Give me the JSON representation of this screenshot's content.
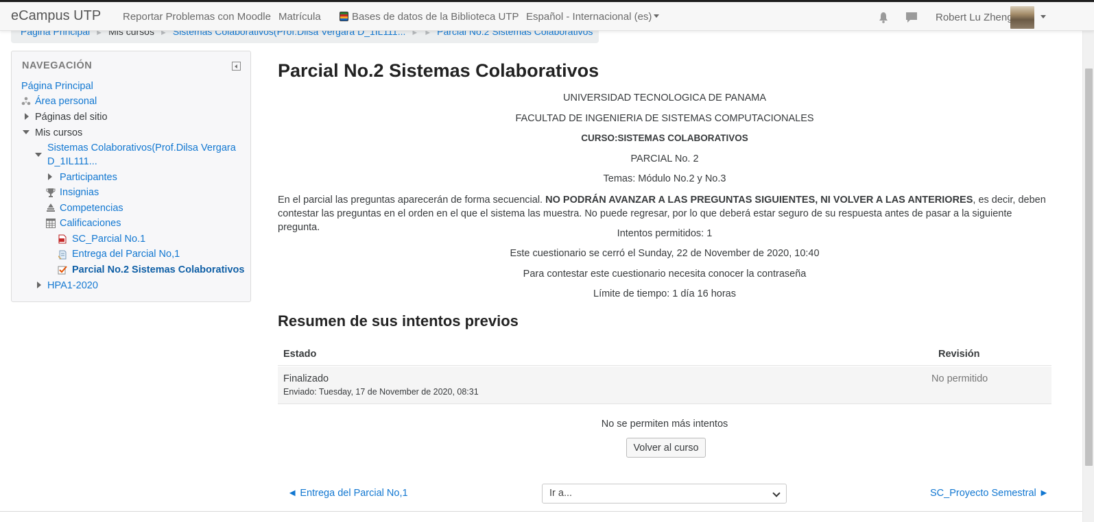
{
  "navbar": {
    "brand": "eCampus UTP",
    "links": [
      "Reportar Problemas con Moodle",
      "Matrícula",
      "Bases de datos de la Biblioteca UTP",
      "Español - Internacional (es)"
    ],
    "user_name": "Robert Lu Zheng"
  },
  "breadcrumb": {
    "items": [
      "Página Principal",
      "Mis cursos",
      "Sistemas Colaborativos(Prof.Dilsa Vergara D_1IL111...",
      "Parcial No.2 Sistemas Colaborativos"
    ]
  },
  "navigation": {
    "title": "NAVEGACIÓN",
    "home": "Página Principal",
    "personal_area": "Área personal",
    "site_pages": "Páginas del sitio",
    "my_courses": "Mis cursos",
    "course_line1": "Sistemas Colaborativos(Prof.Dilsa Vergara",
    "course_line2": "D_1IL111...",
    "participants": "Participantes",
    "badges": "Insignias",
    "competencies": "Competencias",
    "grades": "Calificaciones",
    "activity_1": "SC_Parcial No.1",
    "activity_2": "Entrega del Parcial No,1",
    "activity_3": "Parcial No.2 Sistemas Colaborativos",
    "other_course": "HPA1-2020"
  },
  "main": {
    "title": "Parcial No.2 Sistemas Colaborativos",
    "university": "UNIVERSIDAD TECNOLOGICA DE PANAMA",
    "faculty": "FACULTAD DE INGENIERIA DE SISTEMAS COMPUTACIONALES",
    "course": "CURSO:SISTEMAS COLABORATIVOS",
    "exam": "PARCIAL No. 2",
    "topics": "Temas: Módulo No.2 y No.3",
    "instructions_pre": "En el parcial las preguntas aparecerán de forma secuencial.  ",
    "instructions_bold": "NO PODRÁN AVANZAR A LAS PREGUNTAS SIGUIENTES, NI VOLVER A LAS ANTERIORES",
    "instructions_post": ", es decir, deben contestar las preguntas en el orden en  el que el sistema las muestra.  No puede regresar, por lo que deberá estar seguro de su respuesta antes de pasar a la siguiente pregunta.",
    "attempts_allowed": "Intentos permitidos: 1",
    "closed_on": "Este cuestionario se cerró el Sunday, 22 de November de 2020, 10:40",
    "password_required": "Para contestar este cuestionario necesita conocer la contraseña",
    "time_limit": "Límite de tiempo: 1 día 16 horas",
    "summary_title": "Resumen de sus intentos previos",
    "table": {
      "col_state": "Estado",
      "col_review": "Revisión",
      "row_state": "Finalizado",
      "row_sent": "Enviado: Tuesday, 17 de November de 2020, 08:31",
      "row_review": "No permitido"
    },
    "no_more_attempts": "No se permiten más intentos",
    "back_button": "Volver al curso",
    "prev_activity": "◄ Entrega del Parcial No,1",
    "jump_placeholder": "Ir a...",
    "next_activity": "SC_Proyecto Semestral ►"
  }
}
